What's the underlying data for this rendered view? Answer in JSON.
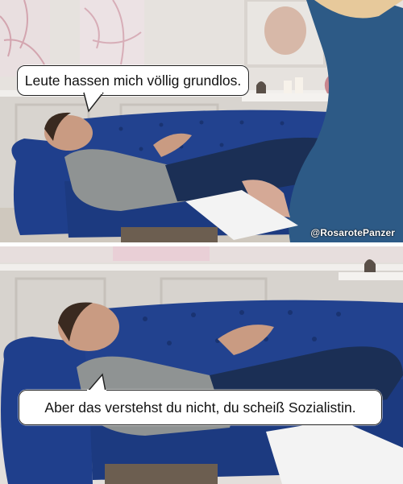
{
  "panels": {
    "top": {
      "speech": "Leute hassen mich völlig grundlos."
    },
    "bottom": {
      "speech": "Aber das verstehst du nicht, du scheiß Sozialistin."
    }
  },
  "watermark": "@RosarotePanzer",
  "colors": {
    "wall": "#e7e3df",
    "wainscot": "#d6d2cd",
    "couch_blue": "#1f3f8c",
    "shirt_grey": "#8e9292",
    "jeans": "#1b2f55",
    "skin": "#c99b82",
    "hair": "#3a2a20",
    "floor": "#8b7a66"
  }
}
